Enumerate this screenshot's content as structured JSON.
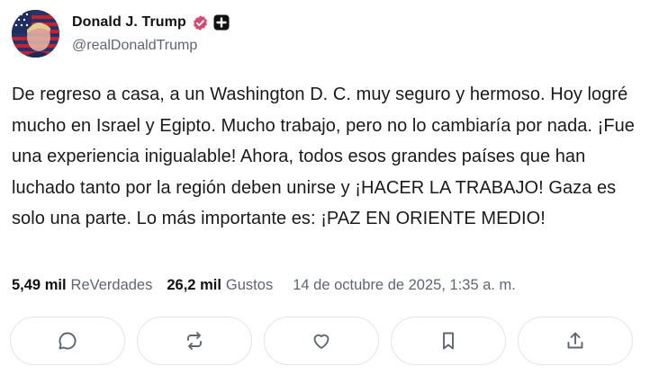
{
  "author": {
    "display_name": "Donald J. Trump",
    "handle": "@realDonaldTrump",
    "verified_icon": "verified-badge-icon",
    "extra_icon": "plus-square-icon",
    "accent_color": "#d94872"
  },
  "post": {
    "text": "De regreso a casa, a un Washington D. C. muy seguro y hermoso. Hoy logré mucho en Israel y Egipto. Mucho trabajo, pero no lo cambiaría por nada. ¡Fue una experiencia inigualable! Ahora, todos esos grandes países que han luchado tanto por la región deben unirse y ¡HACER LA TRABAJO! Gaza es solo una parte. Lo más importante es: ¡PAZ EN ORIENTE MEDIO!"
  },
  "stats": {
    "reposts_count": "5,49 mil",
    "reposts_label": "ReVerdades",
    "likes_count": "26,2 mil",
    "likes_label": "Gustos",
    "date": "14 de octubre de 2025, 1:35 a. m."
  },
  "actions": [
    {
      "icon": "comment-icon"
    },
    {
      "icon": "repost-icon"
    },
    {
      "icon": "heart-icon"
    },
    {
      "icon": "bookmark-icon"
    },
    {
      "icon": "share-icon"
    }
  ]
}
